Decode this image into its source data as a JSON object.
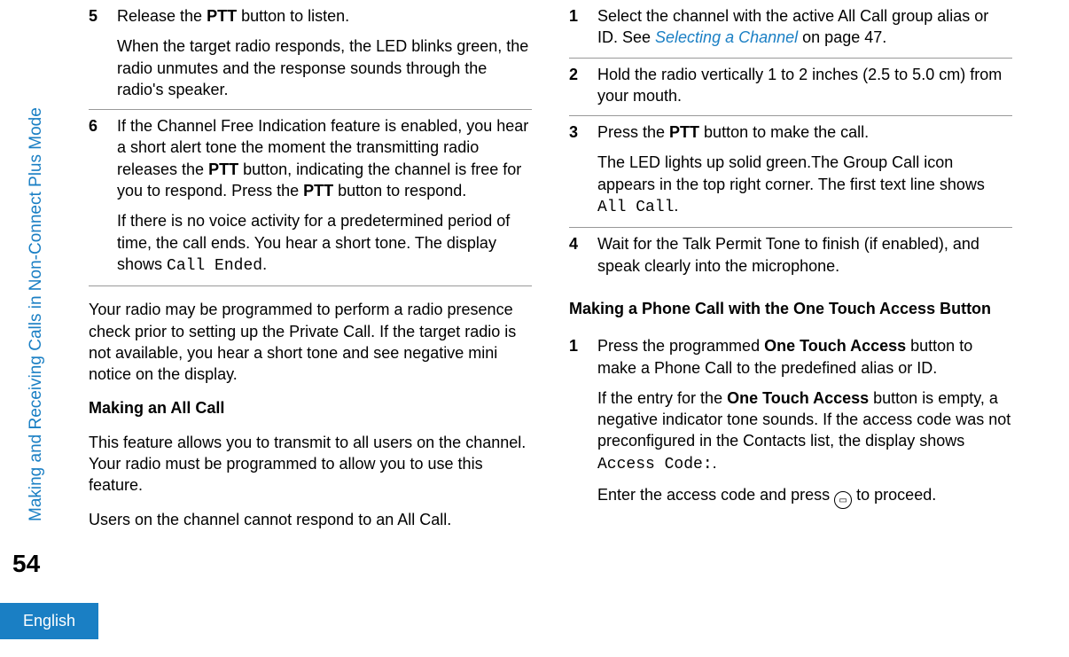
{
  "sidebar": {
    "section": "Making and Receiving Calls in Non-Connect Plus Mode",
    "page_num": "54",
    "language": "English"
  },
  "left": {
    "steps": [
      {
        "num": "5",
        "paras": [
          {
            "runs": [
              {
                "t": "Release the "
              },
              {
                "t": "PTT",
                "b": true
              },
              {
                "t": " button to listen."
              }
            ]
          },
          {
            "runs": [
              {
                "t": "When the target radio responds, the LED blinks green, the radio unmutes and the response sounds through the radio's speaker."
              }
            ]
          }
        ]
      },
      {
        "num": "6",
        "paras": [
          {
            "runs": [
              {
                "t": "If the Channel Free Indication feature is enabled, you hear a short alert tone the moment the transmitting radio releases the "
              },
              {
                "t": "PTT",
                "b": true
              },
              {
                "t": " button, indicating the channel is free for you to respond. Press the "
              },
              {
                "t": "PTT",
                "b": true
              },
              {
                "t": " button to respond."
              }
            ]
          },
          {
            "runs": [
              {
                "t": "If there is no voice activity for a predetermined period of time, the call ends. You hear a short tone. The display shows "
              },
              {
                "t": "Call Ended",
                "mono": true
              },
              {
                "t": "."
              }
            ]
          }
        ]
      }
    ],
    "after_steps_para": {
      "runs": [
        {
          "t": "Your radio may be programmed to perform a radio presence check prior to setting up the Private Call. If the target radio is not available, you hear a short tone and see negative mini notice on the display."
        }
      ]
    },
    "heading": "Making an All Call",
    "body_paras": [
      {
        "runs": [
          {
            "t": "This feature allows you to transmit to all users on the channel. Your radio must be programmed to allow you to use this feature."
          }
        ]
      },
      {
        "runs": [
          {
            "t": "Users on the channel cannot respond to an All Call."
          }
        ]
      }
    ]
  },
  "right": {
    "stepsA": [
      {
        "num": "1",
        "paras": [
          {
            "runs": [
              {
                "t": "Select the channel with the active All Call group alias or ID. See "
              },
              {
                "t": "Selecting a Channel",
                "link": true
              },
              {
                "t": " on page 47."
              }
            ]
          }
        ]
      },
      {
        "num": "2",
        "paras": [
          {
            "runs": [
              {
                "t": "Hold the radio vertically 1 to 2 inches (2.5 to 5.0 cm) from your mouth."
              }
            ]
          }
        ]
      },
      {
        "num": "3",
        "paras": [
          {
            "runs": [
              {
                "t": "Press the "
              },
              {
                "t": "PTT",
                "b": true
              },
              {
                "t": " button to make the call."
              }
            ]
          },
          {
            "runs": [
              {
                "t": "The LED lights up solid green.The Group Call icon appears in the top right corner. The first text line shows "
              },
              {
                "t": "All Call",
                "mono": true
              },
              {
                "t": "."
              }
            ]
          }
        ]
      },
      {
        "num": "4",
        "paras": [
          {
            "runs": [
              {
                "t": "Wait for the Talk Permit Tone to finish (if enabled), and speak clearly into the microphone."
              }
            ]
          }
        ]
      }
    ],
    "heading": "Making a Phone Call with the One Touch Access Button",
    "stepsB": [
      {
        "num": "1",
        "paras": [
          {
            "runs": [
              {
                "t": "Press the programmed "
              },
              {
                "t": "One Touch Access",
                "b": true
              },
              {
                "t": " button to make a Phone Call to the predefined alias or ID."
              }
            ]
          },
          {
            "runs": [
              {
                "t": "If the entry for the "
              },
              {
                "t": "One Touch Access",
                "b": true
              },
              {
                "t": " button is empty, a negative indicator tone sounds. If the access code was not preconfigured in the Contacts list, the display shows "
              },
              {
                "t": "Access Code:",
                "mono": true
              },
              {
                "t": "."
              }
            ]
          },
          {
            "runs": [
              {
                "t": "Enter the access code and press "
              },
              {
                "icon": "ok"
              },
              {
                "t": " to proceed."
              }
            ]
          }
        ]
      }
    ]
  }
}
